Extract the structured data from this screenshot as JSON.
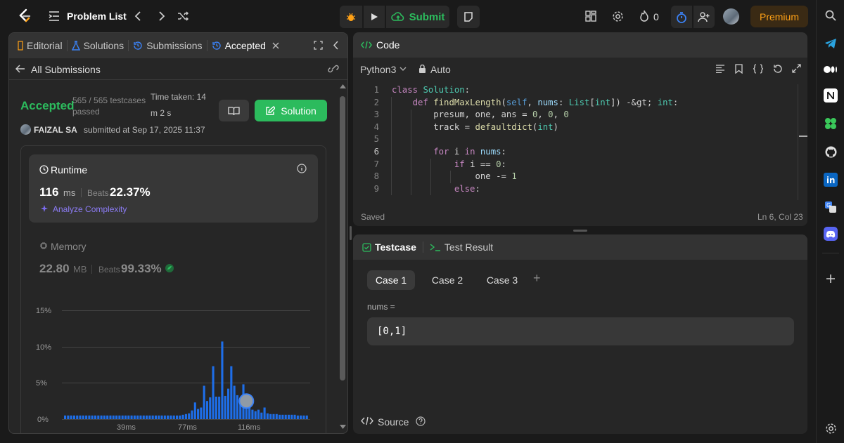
{
  "topbar": {
    "problem_list": "Problem List",
    "submit": "Submit",
    "streak_count": "0",
    "premium": "Premium"
  },
  "left": {
    "tabs": [
      {
        "label": "Editorial",
        "icon": "editorial-icon"
      },
      {
        "label": "Solutions",
        "icon": "flask-icon"
      },
      {
        "label": "Submissions",
        "icon": "history-icon"
      },
      {
        "label": "Accepted",
        "icon": "history-icon"
      }
    ],
    "back": "All Submissions",
    "status": "Accepted",
    "testcases": "565 / 565 testcases passed",
    "time_taken_line1": "Time taken: 14",
    "time_taken_line2": "m 2 s",
    "solution_button": "Solution",
    "author": "FAIZAL SA",
    "submitted": "submitted at Sep 17, 2025 11:37",
    "runtime": {
      "title": "Runtime",
      "value": "116",
      "unit": "ms",
      "beats_label": "Beats",
      "beats": "22.37%",
      "analyze": "Analyze Complexity"
    },
    "memory": {
      "title": "Memory",
      "value": "22.80",
      "unit": "MB",
      "beats_label": "Beats",
      "beats": "99.33%"
    }
  },
  "chart_data": {
    "type": "bar",
    "title": "",
    "xlabel": "",
    "ylabel": "",
    "y_ticks": [
      "15%",
      "10%",
      "5%",
      "0%"
    ],
    "x_ticks": [
      "39ms",
      "77ms",
      "116ms"
    ],
    "ylim": [
      0,
      15
    ],
    "values": [
      0.5,
      0.5,
      0.5,
      0.5,
      0.5,
      0.5,
      0.5,
      0.5,
      0.5,
      0.5,
      0.5,
      0.5,
      0.5,
      0.5,
      0.5,
      0.5,
      0.5,
      0.5,
      0.5,
      0.5,
      0.5,
      0.5,
      0.5,
      0.5,
      0.5,
      0.5,
      0.5,
      0.5,
      0.5,
      0.5,
      0.5,
      0.5,
      0.5,
      0.5,
      0.5,
      0.5,
      0.5,
      0.5,
      0.5,
      0.6,
      0.7,
      0.8,
      1.2,
      2.3,
      1.4,
      1.6,
      4.6,
      2.5,
      3.0,
      7.3,
      3.1,
      3.1,
      10.7,
      3.2,
      4.2,
      7.3,
      4.6,
      3.3,
      2.7,
      4.8,
      2.2,
      2.0,
      1.3,
      1.1,
      1.3,
      0.9,
      1.6,
      0.8,
      0.7,
      0.7,
      0.7,
      0.6,
      0.6,
      0.6,
      0.6,
      0.6,
      0.6,
      0.5,
      0.5,
      0.5,
      0.5
    ],
    "highlight_index": 60,
    "bar_color": "#1e6ee8",
    "grid": true
  },
  "code": {
    "title": "Code",
    "language": "Python3",
    "mode": "Auto",
    "status": "Saved",
    "position": "Ln 6, Col 23",
    "line_numbers": [
      "1",
      "2",
      "3",
      "4",
      "5",
      "6",
      "7",
      "8",
      "9"
    ],
    "lines": [
      "class Solution:",
      "    def findMaxLength(self, nums: List[int]) -> int:",
      "        presum, one, ans = 0, 0, 0",
      "        track = defaultdict(int)",
      "",
      "        for i in nums:",
      "            if i == 0:",
      "                one -= 1",
      "            else:"
    ]
  },
  "testcase": {
    "tab1": "Testcase",
    "tab2": "Test Result",
    "cases": [
      "Case 1",
      "Case 2",
      "Case 3"
    ],
    "add": "+",
    "var_label": "nums =",
    "var_value": "[0,1]",
    "source": "Source"
  },
  "rail_icons": [
    "search-icon",
    "telegram-icon",
    "medium-icon",
    "notion-icon",
    "apps-icon",
    "github-icon",
    "linkedin-icon",
    "translate-icon",
    "discord-icon",
    "add-icon",
    "settings-icon"
  ],
  "colors": {
    "accent_green": "#2cbb5d",
    "premium": "#ffa116",
    "bar": "#1e6ee8",
    "timer_blue": "#3b82f6"
  }
}
